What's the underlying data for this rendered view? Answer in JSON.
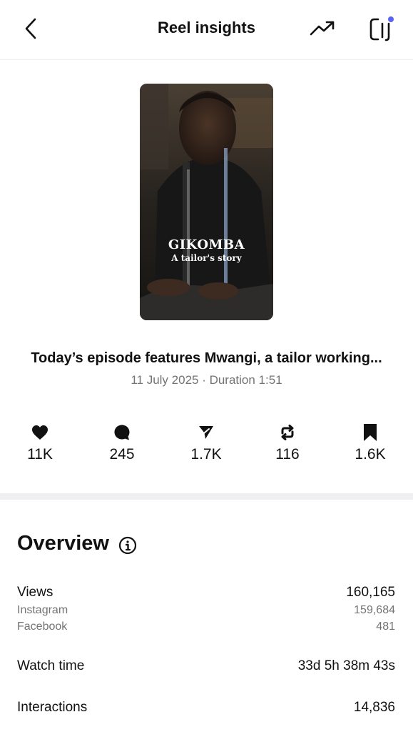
{
  "header": {
    "title": "Reel insights",
    "back_icon": "chevron-left-icon",
    "trend_icon": "trending-up-icon",
    "panel_icon": "side-panel-icon",
    "notification_dot_color": "#5b63f5"
  },
  "reel": {
    "thumbnail_title": "GIKOMBA",
    "thumbnail_subtitle": "A tailor's story",
    "caption": "Today’s episode features Mwangi, a tailor working...",
    "date_duration": "11 July 2025 · Duration 1:51"
  },
  "stats": [
    {
      "icon": "heart-icon",
      "value": "11K"
    },
    {
      "icon": "comment-icon",
      "value": "245"
    },
    {
      "icon": "share-icon",
      "value": "1.7K"
    },
    {
      "icon": "repost-icon",
      "value": "116"
    },
    {
      "icon": "bookmark-icon",
      "value": "1.6K"
    }
  ],
  "overview": {
    "title": "Overview",
    "info_icon": "info-icon",
    "views": {
      "label": "Views",
      "value": "160,165",
      "breakdown": [
        {
          "label": "Instagram",
          "value": "159,684"
        },
        {
          "label": "Facebook",
          "value": "481"
        }
      ]
    },
    "watch_time": {
      "label": "Watch time",
      "value": "33d 5h 38m 43s"
    },
    "interactions": {
      "label": "Interactions",
      "value": "14,836"
    }
  }
}
